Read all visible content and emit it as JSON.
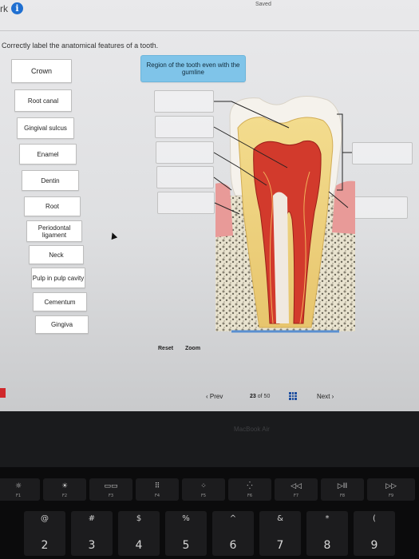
{
  "header": {
    "title_fragment": "rk",
    "saved_label": "Saved"
  },
  "question": {
    "instructions": "Correctly label the anatomical features of a tooth."
  },
  "labels": [
    {
      "text": "Crown"
    },
    {
      "text": "Root canal"
    },
    {
      "text": "Gingival sulcus"
    },
    {
      "text": "Enamel"
    },
    {
      "text": "Dentin"
    },
    {
      "text": "Root"
    },
    {
      "text": "Periodontal ligament"
    },
    {
      "text": "Neck"
    },
    {
      "text": "Pulp in pulp cavity"
    },
    {
      "text": "Cementum"
    },
    {
      "text": "Gingiva"
    }
  ],
  "placed_label": {
    "text": "Region of the tooth even with the gumline"
  },
  "controls": {
    "reset": "Reset",
    "zoom": "Zoom"
  },
  "pagination": {
    "prev": "Prev",
    "current": "23",
    "of": "of",
    "total": "50",
    "next": "Next"
  },
  "laptop": {
    "brand": "MacBook Air"
  },
  "keyboard": {
    "fkeys": [
      {
        "glyph": "☼",
        "label": "F1"
      },
      {
        "glyph": "☀",
        "label": "F2"
      },
      {
        "glyph": "▭▭",
        "label": "F3"
      },
      {
        "glyph": "⠿",
        "label": "F4"
      },
      {
        "glyph": "⁘",
        "label": "F5"
      },
      {
        "glyph": "⁛",
        "label": "F6"
      },
      {
        "glyph": "◁◁",
        "label": "F7"
      },
      {
        "glyph": "▷II",
        "label": "F8"
      },
      {
        "glyph": "▷▷",
        "label": "F9"
      }
    ],
    "numkeys": [
      {
        "sym": "@",
        "num": "2"
      },
      {
        "sym": "#",
        "num": "3"
      },
      {
        "sym": "$",
        "num": "4"
      },
      {
        "sym": "%",
        "num": "5"
      },
      {
        "sym": "^",
        "num": "6"
      },
      {
        "sym": "&",
        "num": "7"
      },
      {
        "sym": "*",
        "num": "8"
      },
      {
        "sym": "(",
        "num": "9"
      }
    ]
  },
  "colors": {
    "accent_blue": "#7fc4e9",
    "info_blue": "#1f6fd1",
    "grid_blue": "#1e4fa0",
    "red_tab": "#d0282b"
  }
}
